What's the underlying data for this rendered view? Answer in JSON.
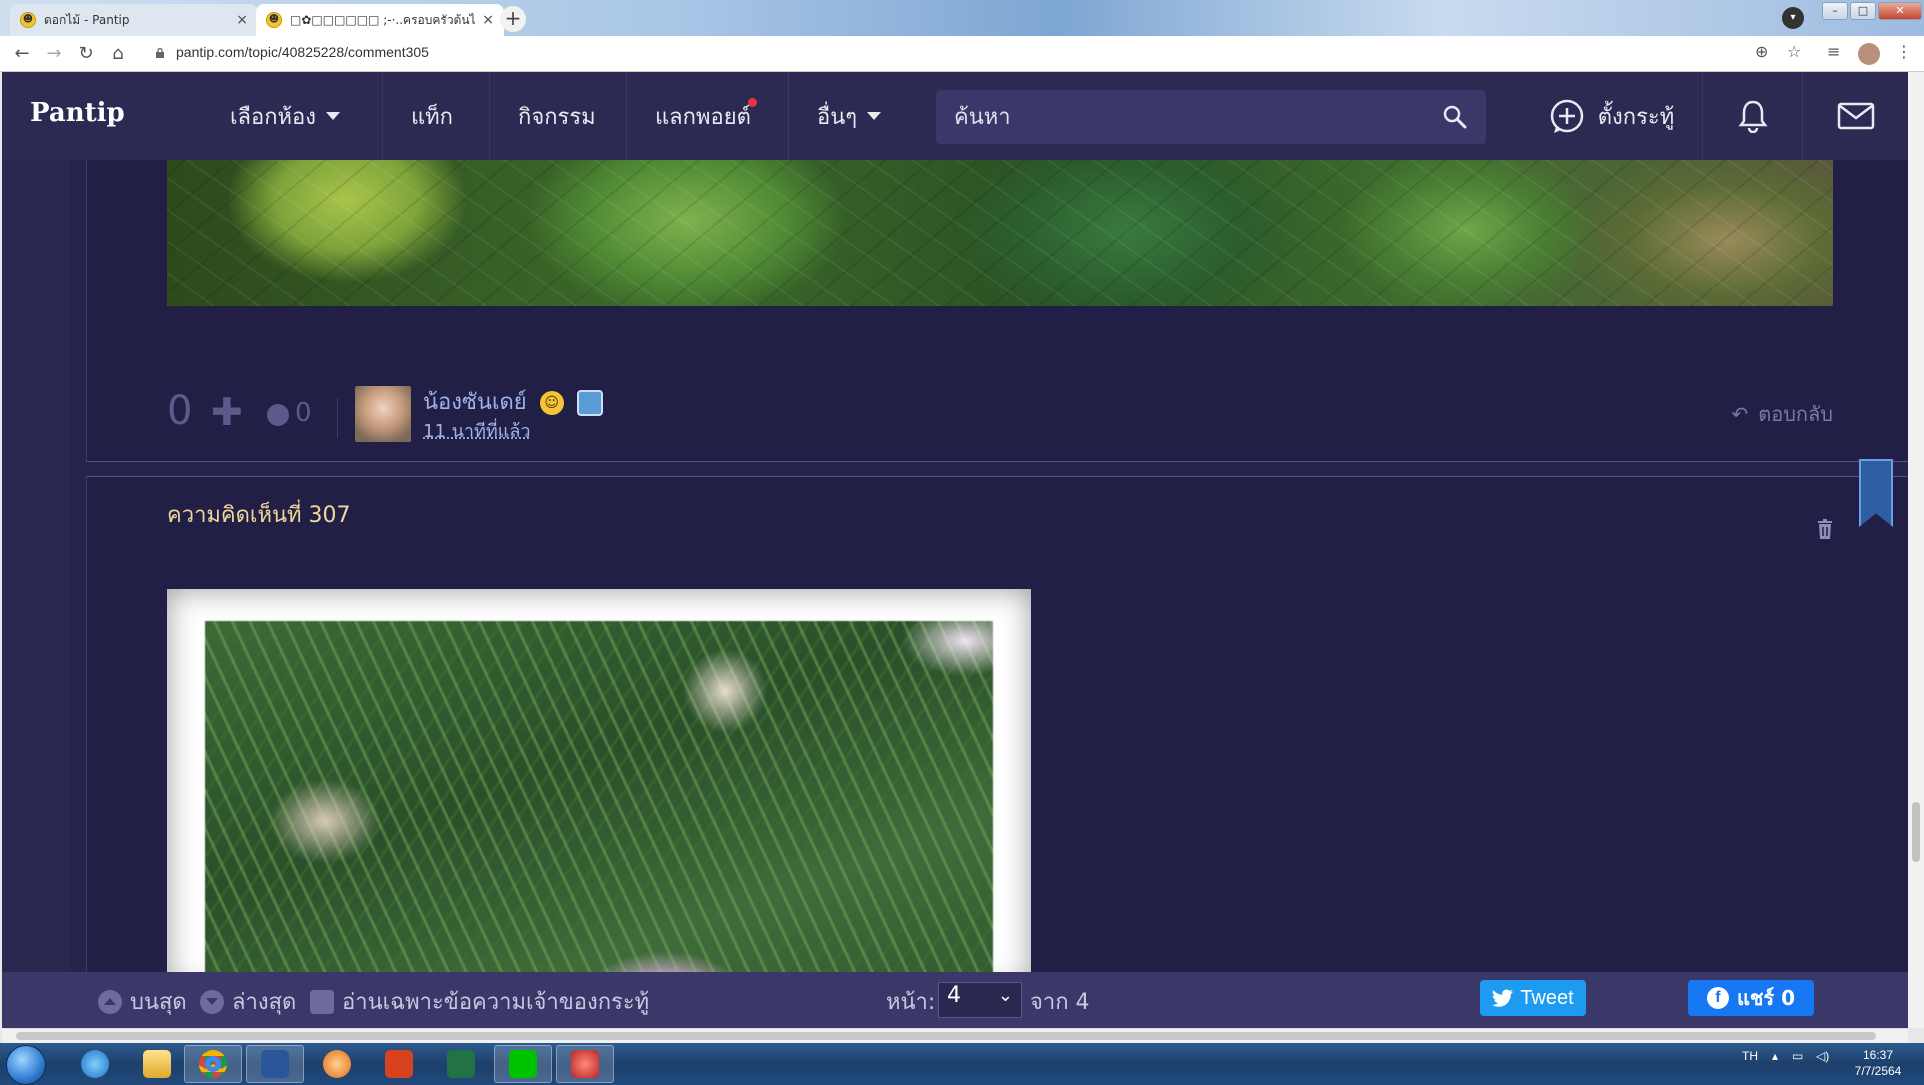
{
  "browser": {
    "tabs": [
      {
        "title": "ดอกไม้ - Pantip",
        "active": false
      },
      {
        "title": "□✿□□□□□□ ;-·..ครอบครัวต้นไม้กระ",
        "active": true
      }
    ],
    "url": "pantip.com/topic/40825228/comment305",
    "new_tab_label": "+",
    "close_label": "×"
  },
  "nav": {
    "logo": "Pantip",
    "menu": [
      {
        "label": "เลือกห้อง",
        "has_caret": true
      },
      {
        "label": "แท็ก"
      },
      {
        "label": "กิจกรรม"
      },
      {
        "label": "แลกพอยต์",
        "has_dot": true
      },
      {
        "label": "อื่นๆ",
        "has_caret": true
      }
    ],
    "search_placeholder": "ค้นหา",
    "post_label": "ตั้งกระทู้"
  },
  "comment_prev": {
    "vote_count": "0",
    "emotion_count": "0",
    "username": "น้องซันเดย์",
    "time": "11 นาทีที่แล้ว",
    "reply_label": "ตอบกลับ"
  },
  "comment_current": {
    "title": "ความคิดเห็นที่ 307"
  },
  "bottom_bar": {
    "top_label": "บนสุด",
    "bottom_label": "ล่างสุด",
    "owner_only_label": "อ่านเฉพาะข้อความเจ้าของกระทู้",
    "page_label": "หน้า:",
    "page_value": "4",
    "of_label": "จาก 4",
    "tweet_label": "Tweet",
    "share_label": "แชร์ 0"
  },
  "taskbar": {
    "lang": "TH",
    "time": "16:37",
    "date": "7/7/2564"
  },
  "colors": {
    "page_bg": "#26244a",
    "nav_bg": "#2c2a52",
    "accent_title": "#f0d89a",
    "link": "#9fb3ea"
  }
}
